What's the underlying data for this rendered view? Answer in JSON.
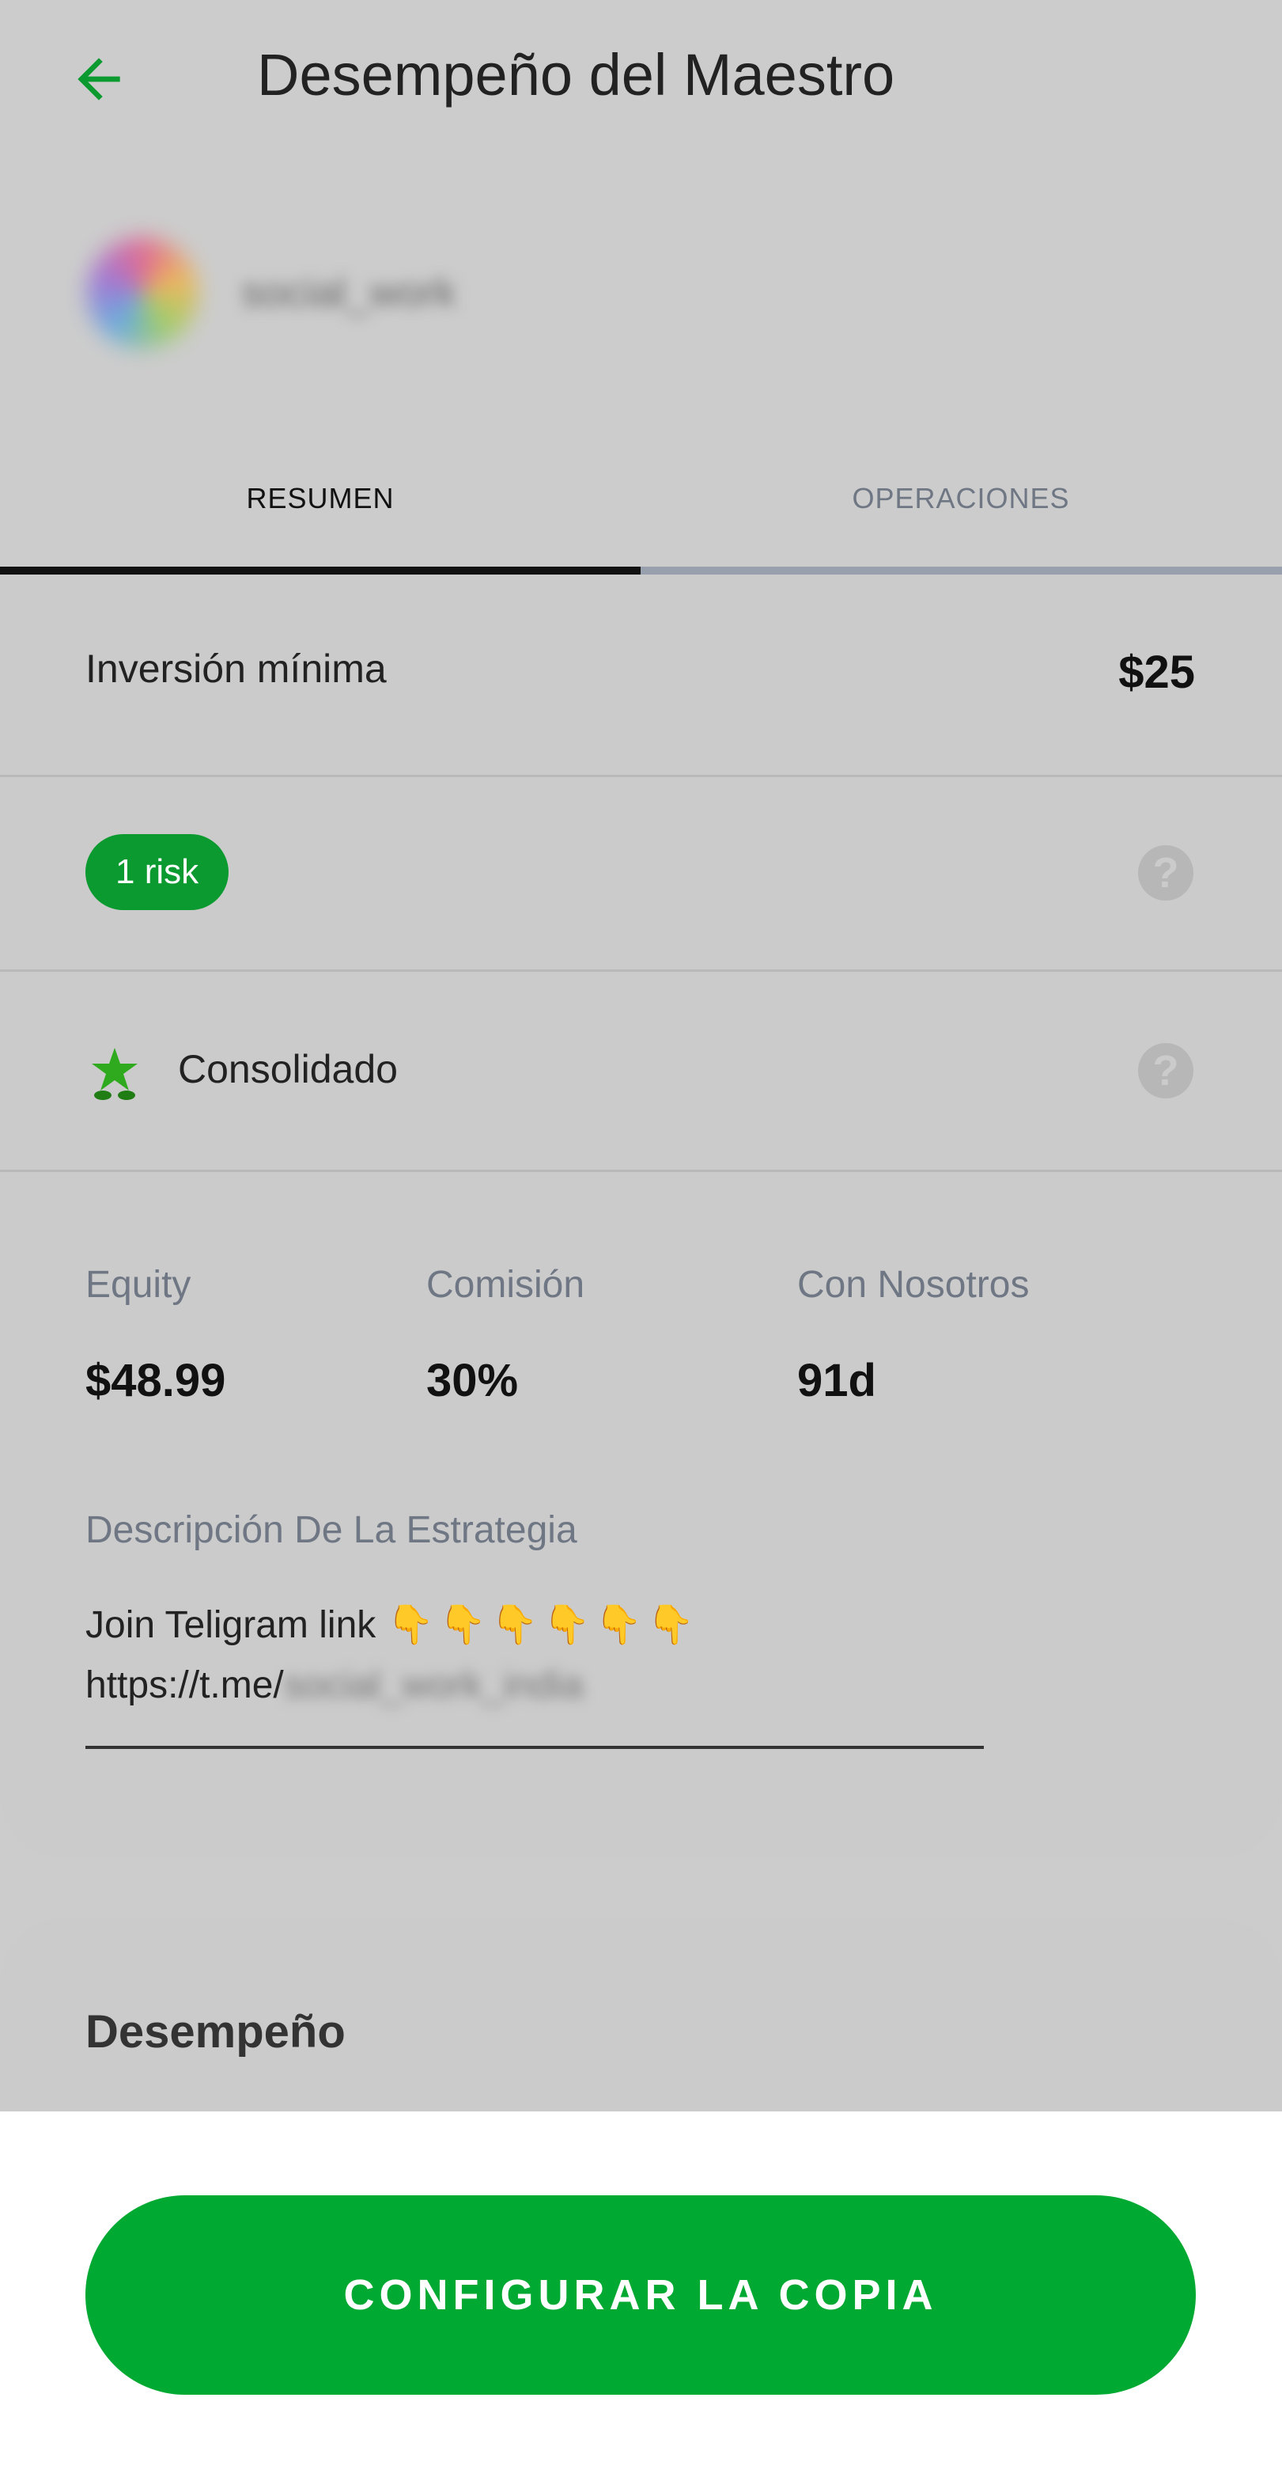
{
  "header": {
    "title": "Desempeño del Maestro",
    "back_icon": "arrow-left-icon",
    "back_icon_color": "#0a9a2f"
  },
  "master": {
    "name": "social_work"
  },
  "tabs": [
    {
      "label": "RESUMEN",
      "active": true
    },
    {
      "label": "OPERACIONES",
      "active": false
    }
  ],
  "summary": {
    "min_investment_label": "Inversión mínima",
    "min_investment_value": "$25",
    "risk_badge": "1 risk",
    "risk_badge_color": "#0a9a2f",
    "level_label": "Consolidado",
    "level_icon": "star-sprout-icon",
    "help_icon": "question-circle-icon"
  },
  "stats": {
    "equity_label": "Equity",
    "equity_value": "$48.99",
    "commission_label": "Comisión",
    "commission_value": "30%",
    "with_us_label": "Con Nosotros",
    "with_us_value": "91d"
  },
  "description": {
    "label": "Descripción De La Estrategia",
    "line1": "Join Teligram link",
    "emojis": "👇👇👇👇👇👇",
    "link_prefix": "https://t.me/",
    "link_handle": "social_work_india"
  },
  "performance": {
    "title": "Desempeño"
  },
  "cta": {
    "label": "CONFIGURAR LA COPIA",
    "color": "#00a932"
  }
}
